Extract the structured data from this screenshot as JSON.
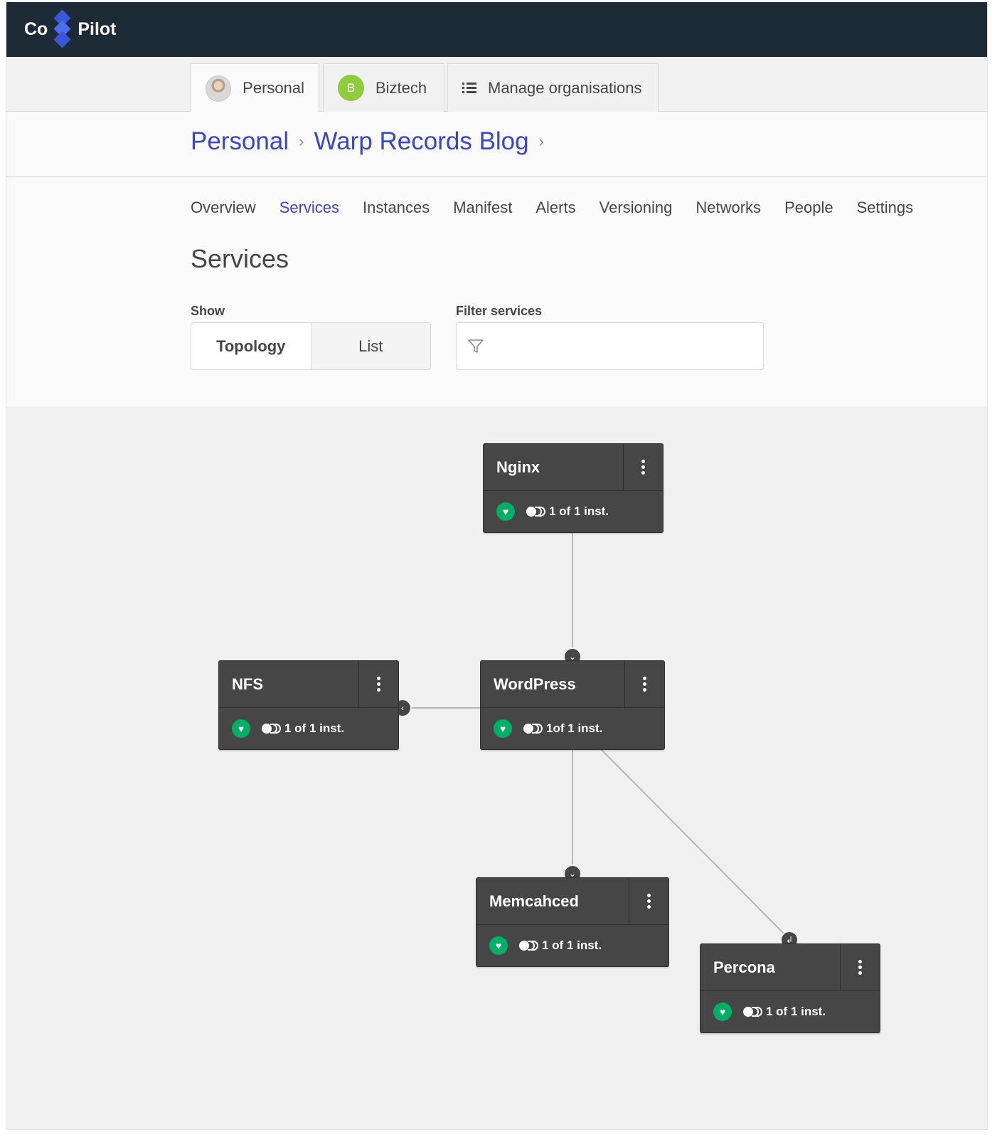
{
  "app": {
    "logo_left": "Co",
    "logo_right": "Pilot"
  },
  "org_tabs": [
    {
      "label": "Personal",
      "icon": "avatar"
    },
    {
      "label": "Biztech",
      "badge": "B",
      "badge_color": "#8fcb3d"
    },
    {
      "label": "Manage organisations",
      "icon": "list-icon"
    }
  ],
  "breadcrumb": [
    "Personal",
    "Warp Records Blog"
  ],
  "nav": [
    "Overview",
    "Services",
    "Instances",
    "Manifest",
    "Alerts",
    "Versioning",
    "Networks",
    "People",
    "Settings"
  ],
  "nav_active": "Services",
  "page_title": "Services",
  "show": {
    "label": "Show",
    "options": [
      "Topology",
      "List"
    ],
    "selected": "Topology"
  },
  "filter": {
    "label": "Filter services",
    "value": "",
    "placeholder": ""
  },
  "services": [
    {
      "name": "Nginx",
      "instances": "1 of 1 inst.",
      "health": "healthy"
    },
    {
      "name": "NFS",
      "instances": "1 of 1 inst.",
      "health": "healthy"
    },
    {
      "name": "WordPress",
      "instances": "1of 1 inst.",
      "health": "healthy"
    },
    {
      "name": "Memcahced",
      "instances": "1 of 1 inst.",
      "health": "healthy"
    },
    {
      "name": "Percona",
      "instances": "1 of 1 inst.",
      "health": "healthy"
    }
  ],
  "colors": {
    "accent": "#3b46c4",
    "topbar": "#1c2b36",
    "node": "#464646",
    "healthy": "#00af66"
  }
}
